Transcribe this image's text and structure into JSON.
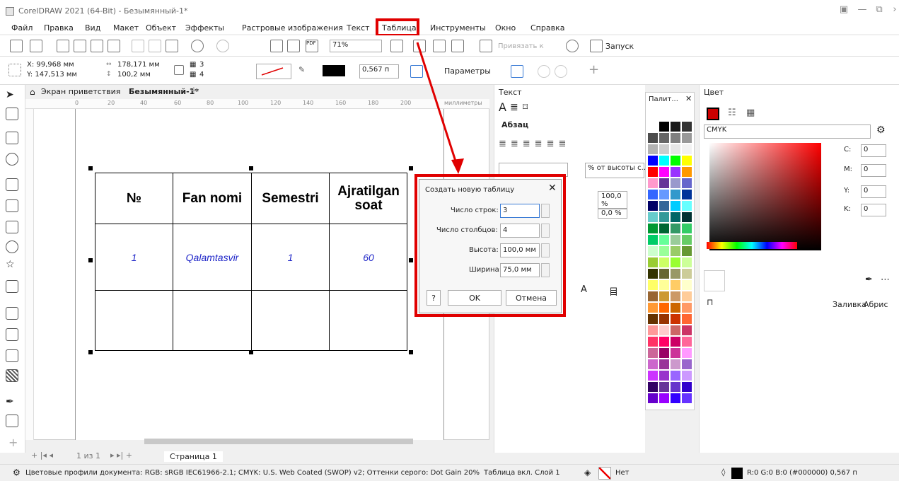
{
  "window": {
    "title": "CorelDRAW 2021 (64-Bit) - Безымянный-1*",
    "min": "—",
    "restore": "⧉",
    "close": "›"
  },
  "menu": [
    "Файл",
    "Правка",
    "Вид",
    "Макет",
    "Объект",
    "Эффекты",
    "Растровые изображения",
    "Текст",
    "Таблица",
    "Инструменты",
    "Окно",
    "Справка"
  ],
  "toolbar1": {
    "zoom": "71%",
    "snap": "Привязать к",
    "launch": "Запуск"
  },
  "toolbar2": {
    "x": "X: 99,968 мм",
    "y": "Y: 147,513 мм",
    "w": "178,171 мм",
    "h": "100,2 мм",
    "rows": "3",
    "cols": "4",
    "outline": "0,567 п",
    "params": "Параметры"
  },
  "tabs": {
    "welcome": "Экран приветствия",
    "doc": "Безымянный-1*"
  },
  "ruler": {
    "ticks": [
      "0",
      "20",
      "40",
      "60",
      "80",
      "100",
      "120",
      "140",
      "160",
      "180",
      "200"
    ],
    "unit": "миллиметры"
  },
  "table": {
    "headers": [
      "№",
      "Fan nomi",
      "Semestri",
      "Ajratilgan soat"
    ],
    "row1": [
      "1",
      "Qalamtasvir",
      "1",
      "60"
    ]
  },
  "pagebar": {
    "count": "1 из 1",
    "page": "Страница 1"
  },
  "status": {
    "profiles": "Цветовые профили документа: RGB: sRGB IEC61966-2.1; CMYK: U.S. Web Coated (SWOP) v2; Оттенки серого: Dot Gain 20%",
    "layer": "Таблица вкл. Слой 1",
    "fill": "Нет",
    "color": "R:0 G:0 B:0 (#000000) 0,567 п"
  },
  "textpanel": {
    "title": "Текст",
    "para": "Абзац",
    "height": "% от высоты с...",
    "v1": "100,0 %",
    "v2": "0,0 %"
  },
  "palette": {
    "title": "Палит..."
  },
  "colorpanel": {
    "title": "Цвет",
    "model": "CMYK",
    "c": "0",
    "m": "0",
    "y": "0",
    "k": "0",
    "fill": "Заливка",
    "outline": "Абрис",
    "c_label": "C:",
    "m_label": "M:",
    "y_label": "Y:",
    "k_label": "K:"
  },
  "dialog": {
    "title": "Создать новую таблицу",
    "rows_label": "Число строк:",
    "rows": "3",
    "cols_label": "Число столбцов:",
    "cols": "4",
    "h_label": "Высота:",
    "h": "100,0 мм",
    "w_label": "Ширина:",
    "w": "75,0 мм",
    "help": "?",
    "ok": "OK",
    "cancel": "Отмена"
  },
  "colors": {
    "highlight": "#e00000",
    "link": "#1f26c8"
  }
}
